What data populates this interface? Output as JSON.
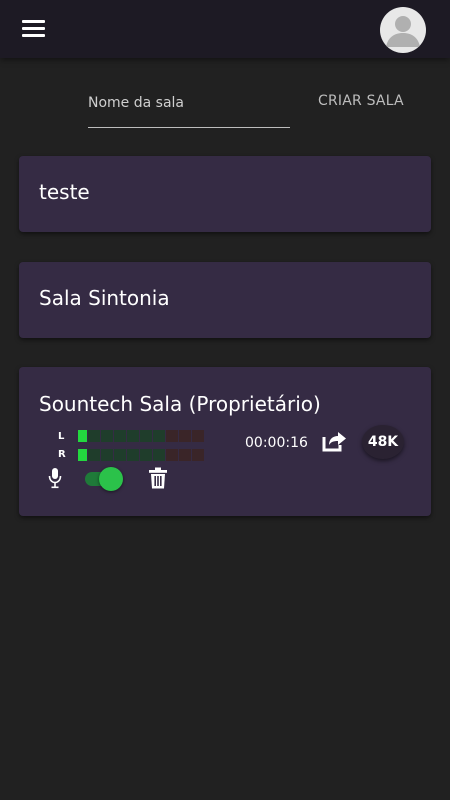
{
  "appbar": {
    "menu_icon": "menu-icon",
    "avatar_icon": "account-avatar-icon"
  },
  "create": {
    "room_name_placeholder": "Nome da sala",
    "create_button": "CRIAR SALA"
  },
  "rooms": [
    {
      "title": "teste"
    },
    {
      "title": "Sala Sintonia"
    },
    {
      "title": "Sountech Sala (Proprietário)",
      "meter": {
        "left_label": "L",
        "right_label": "R",
        "left_level": 0.1,
        "right_level": 0.1
      },
      "timer": "00:00:16",
      "bitrate": "48K",
      "mic_toggle_on": true,
      "icons": [
        "microphone-icon",
        "share-icon",
        "trash-icon"
      ]
    }
  ],
  "colors": {
    "background": "#212121",
    "appbar": "#1d1a24",
    "card": "#352b44",
    "meter_on": "#23d83f",
    "toggle_on": "#2bc24a"
  }
}
